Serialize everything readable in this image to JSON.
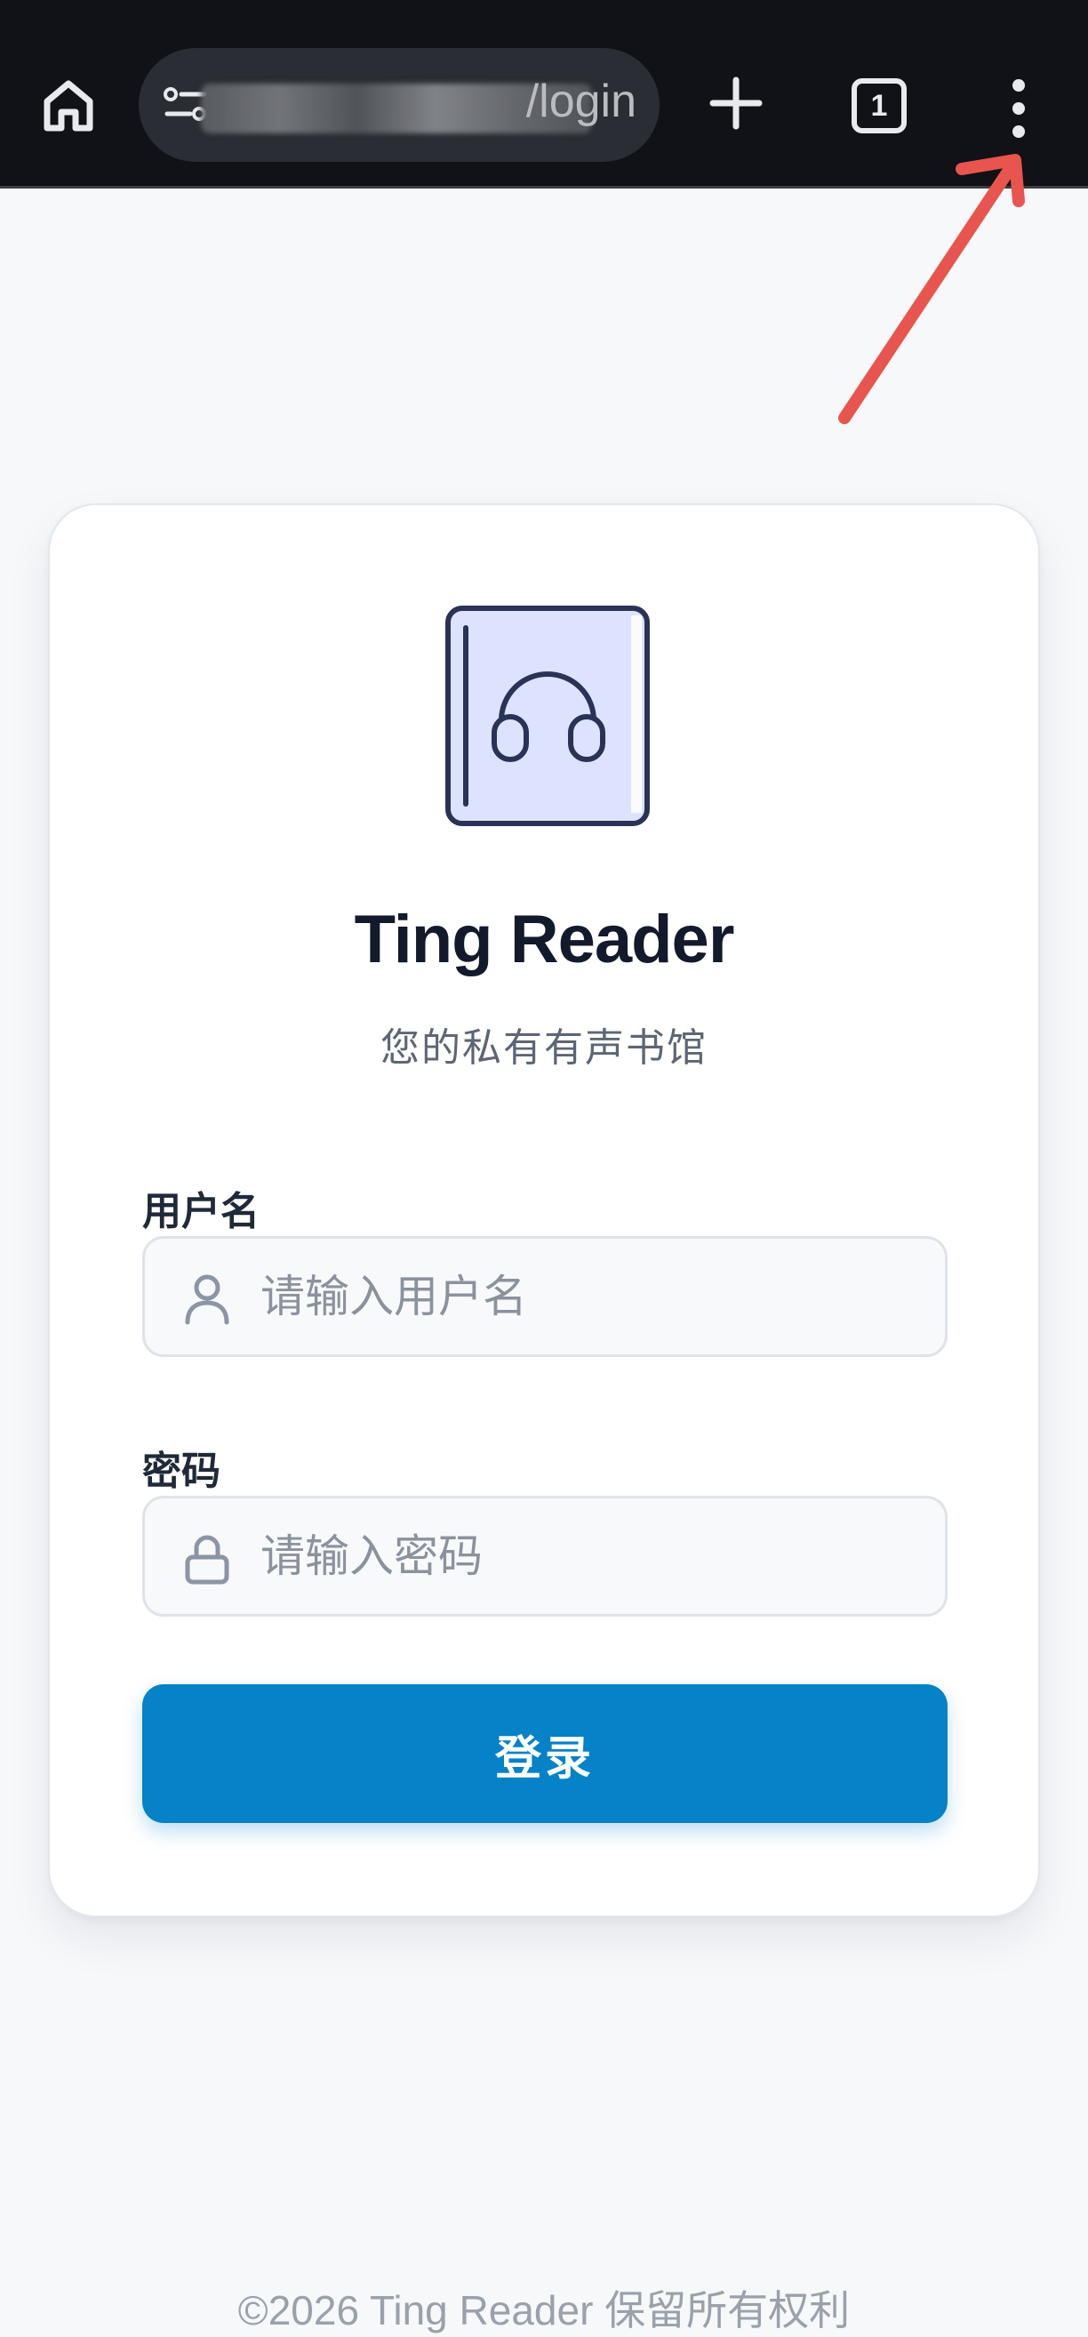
{
  "browser": {
    "url_visible_suffix": "/login",
    "tab_count": "1",
    "icons": {
      "home": "home-icon",
      "site_info": "site-info-icon",
      "new_tab": "plus-icon",
      "menu": "more-vert-icon"
    }
  },
  "app": {
    "title": "Ting Reader",
    "subtitle": "您的私有有声书馆"
  },
  "form": {
    "username_label": "用户名",
    "username_placeholder": "请输入用户名",
    "password_label": "密码",
    "password_placeholder": "请输入密码",
    "submit_label": "登录"
  },
  "footer": {
    "text": "©2026 Ting Reader 保留所有权利"
  },
  "colors": {
    "primary": "#0582c8",
    "annotation_arrow": "#e8554e",
    "logo_fill": "#dde3ff",
    "logo_stroke": "#2a3256"
  }
}
